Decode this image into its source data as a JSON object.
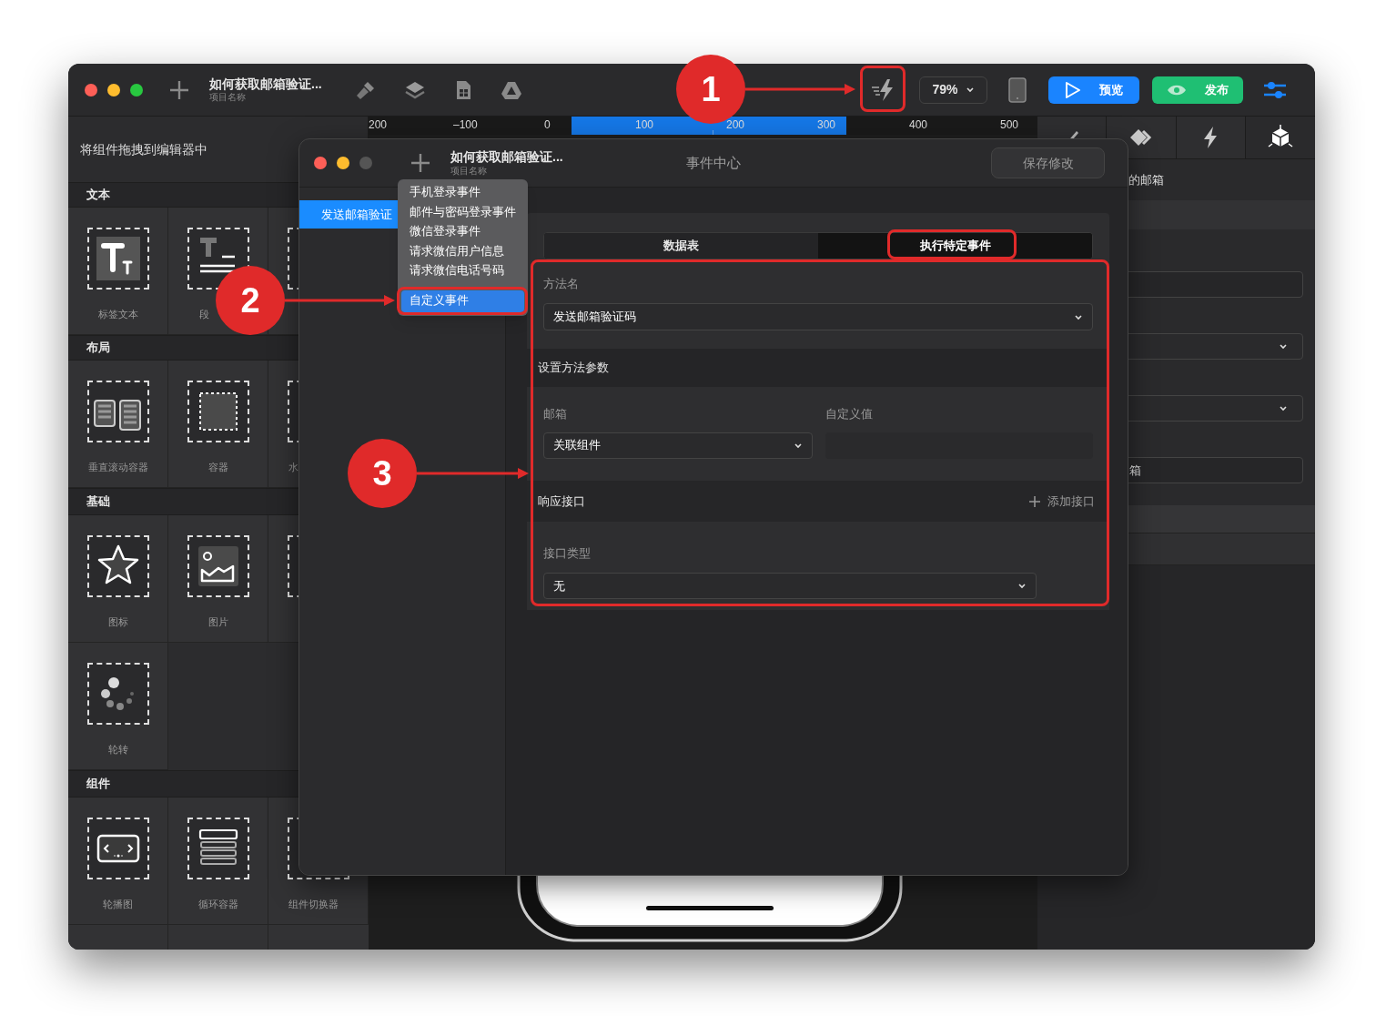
{
  "main_window": {
    "title": "如何获取邮箱验证...",
    "subtitle": "项目名称",
    "toolbar": {
      "zoom": "79%",
      "preview_button": "预览",
      "publish_button": "发布"
    },
    "ruler": [
      "200",
      "–100",
      "0",
      "100",
      "200",
      "300",
      "400",
      "500"
    ],
    "left_panel": {
      "hint": "将组件拖拽到编辑器中",
      "sections": [
        {
          "title": "文本",
          "items": [
            {
              "kind": "text",
              "label": "标签文本"
            },
            {
              "kind": "paragraph",
              "label": "段"
            },
            {
              "kind": "partial"
            }
          ]
        },
        {
          "title": "布局",
          "items": [
            {
              "kind": "scroll",
              "label": "垂直滚动容器"
            },
            {
              "kind": "container",
              "label": "容器"
            },
            {
              "kind": "partial",
              "label": "水"
            }
          ]
        },
        {
          "title": "基础",
          "items": [
            {
              "kind": "star",
              "label": "图标"
            },
            {
              "kind": "image",
              "label": "图片"
            },
            {
              "kind": "partial"
            },
            {
              "kind": "spinner",
              "label": "轮转"
            }
          ]
        },
        {
          "title": "组件",
          "items": [
            {
              "kind": "carousel",
              "label": "轮播图"
            },
            {
              "kind": "list",
              "label": "循环容器"
            },
            {
              "kind": "partial",
              "label": "组件切换器"
            }
          ]
        }
      ]
    },
    "right_panel": {
      "label": "的邮箱",
      "fields": [
        {
          "kind": "input"
        },
        {
          "kind": "select"
        },
        {
          "kind": "select"
        },
        {
          "kind": "input",
          "value": "箱"
        }
      ]
    }
  },
  "dialog": {
    "title": "如何获取邮箱验证...",
    "subtitle": "项目名称",
    "heading": "事件中心",
    "save_button": "保存修改",
    "events": [
      {
        "label": "发送邮箱验证",
        "selected": true
      }
    ],
    "menu": [
      {
        "label": "手机登录事件",
        "selected": false
      },
      {
        "label": "邮件与密码登录事件",
        "selected": false
      },
      {
        "label": "微信登录事件",
        "selected": false
      },
      {
        "label": "请求微信用户信息",
        "selected": false
      },
      {
        "label": "请求微信电话号码",
        "selected": false
      },
      {
        "label": "自定义事件",
        "selected": true
      }
    ],
    "tabs": [
      {
        "label": "数据表",
        "selected": false
      },
      {
        "label": "执行特定事件",
        "selected": true
      }
    ],
    "method": {
      "label": "方法名",
      "value": "发送邮箱验证码"
    },
    "params": {
      "title": "设置方法参数",
      "fields": [
        {
          "label": "邮箱",
          "kind": "select",
          "value": "关联组件"
        },
        {
          "label": "自定义值",
          "kind": "input"
        }
      ]
    },
    "response": {
      "title": "响应接口",
      "add_button": "添加接口",
      "type_label": "接口类型",
      "type_value": "无"
    }
  },
  "annotations": [
    {
      "number": "1"
    },
    {
      "number": "2"
    },
    {
      "number": "3"
    }
  ]
}
